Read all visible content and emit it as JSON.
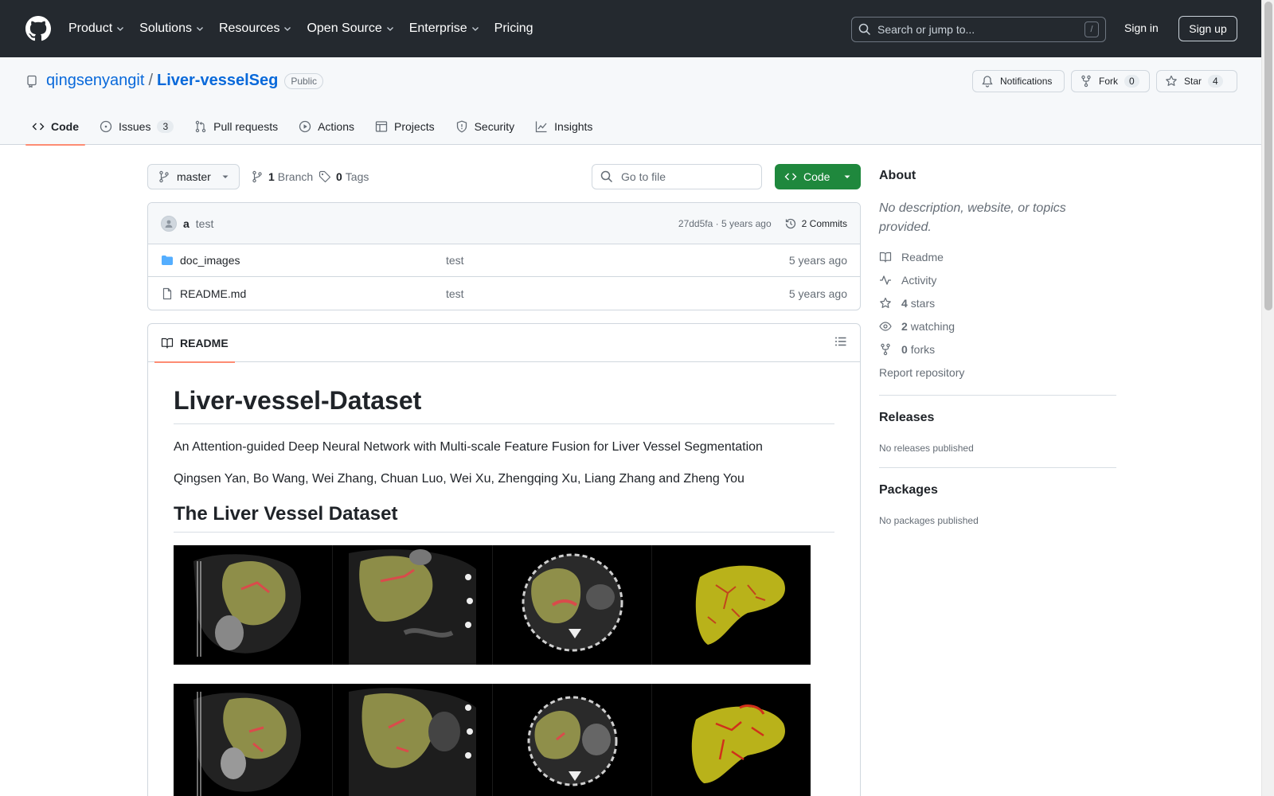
{
  "header": {
    "nav": [
      "Product",
      "Solutions",
      "Resources",
      "Open Source",
      "Enterprise",
      "Pricing"
    ],
    "search_placeholder": "Search or jump to...",
    "search_shortcut": "/",
    "signin": "Sign in",
    "signup": "Sign up"
  },
  "repo": {
    "owner": "qingsenyangit",
    "separator": "/",
    "name": "Liver-vesselSeg",
    "visibility": "Public",
    "notifications_label": "Notifications",
    "fork_label": "Fork",
    "fork_count": "0",
    "star_label": "Star",
    "star_count": "4"
  },
  "tabs": {
    "code": "Code",
    "issues": "Issues",
    "issues_count": "3",
    "pulls": "Pull requests",
    "actions": "Actions",
    "projects": "Projects",
    "security": "Security",
    "insights": "Insights"
  },
  "browser": {
    "branch": "master",
    "branch_count": "1",
    "branch_label": "Branch",
    "tag_count": "0",
    "tag_label": "Tags",
    "goto_placeholder": "Go to file",
    "code_button": "Code",
    "commit": {
      "author": "a",
      "message": "test",
      "sha_info": "27dd5fa · 5 years ago",
      "commits_label": "2 Commits"
    },
    "files": [
      {
        "name": "doc_images",
        "type": "folder",
        "message": "test",
        "date": "5 years ago"
      },
      {
        "name": "README.md",
        "type": "file",
        "message": "test",
        "date": "5 years ago"
      }
    ]
  },
  "readme": {
    "tab_label": "README",
    "h1": "Liver-vessel-Dataset",
    "p1": "An Attention-guided Deep Neural Network with Multi-scale Feature Fusion for Liver Vessel Segmentation",
    "p2": "Qingsen Yan, Bo Wang, Wei Zhang, Chuan Luo, Wei Xu, Zhengqing Xu, Liang Zhang and Zheng You",
    "h2": "The Liver Vessel Dataset"
  },
  "sidebar": {
    "about_title": "About",
    "about_desc": "No description, website, or topics provided.",
    "readme": "Readme",
    "activity": "Activity",
    "stars_count": "4",
    "stars_label": "stars",
    "watching_count": "2",
    "watching_label": "watching",
    "forks_count": "0",
    "forks_label": "forks",
    "report": "Report repository",
    "releases_title": "Releases",
    "releases_empty": "No releases published",
    "packages_title": "Packages",
    "packages_empty": "No packages published"
  },
  "colors": {
    "header_bg": "#24292f",
    "link": "#0969da",
    "primary_button": "#1f883d",
    "tab_underline": "#fd8c73"
  }
}
